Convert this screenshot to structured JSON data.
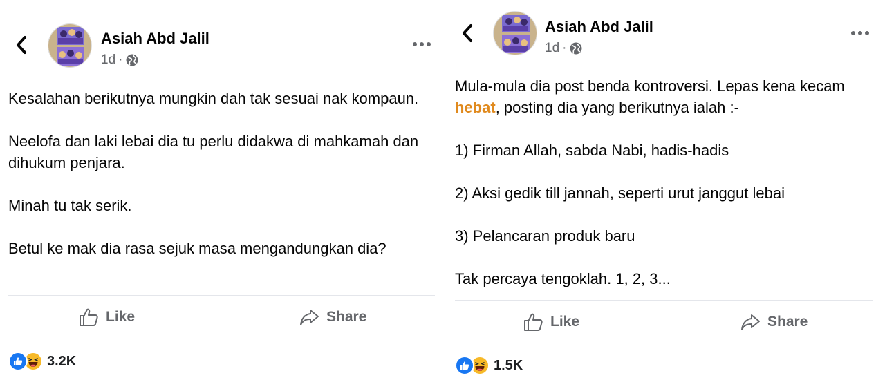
{
  "posts": [
    {
      "author": "Asiah Abd Jalil",
      "time": "1d",
      "separator": "·",
      "paragraphs": [
        "Kesalahan berikutnya mungkin dah tak sesuai nak kompaun.",
        "Neelofa dan laki lebai dia tu perlu didakwa di mahkamah dan dihukum penjara.",
        "Minah tu tak serik.",
        "Betul ke mak dia rasa sejuk masa mengandungkan dia?"
      ],
      "like_label": "Like",
      "share_label": "Share",
      "reaction_count": "3.2K"
    },
    {
      "author": "Asiah Abd Jalil",
      "time": "1d",
      "separator": "·",
      "intro_before": "Mula-mula dia post benda kontroversi. Lepas kena kecam ",
      "intro_highlight": "hebat",
      "intro_after": ", posting dia yang berikutnya ialah :-",
      "list": [
        "1) Firman Allah, sabda Nabi, hadis-hadis",
        "2) Aksi gedik till jannah, seperti urut janggut lebai",
        "3) Pelancaran produk baru"
      ],
      "closing": "Tak percaya tengoklah. 1, 2, 3...",
      "like_label": "Like",
      "share_label": "Share",
      "reaction_count": "1.5K"
    }
  ],
  "icons": {
    "back": "chevron-left-icon",
    "privacy": "globe-icon",
    "more": "more-horizontal-icon",
    "like": "thumbs-up-icon",
    "share": "share-arrow-icon",
    "reaction_like": "like-reaction-icon",
    "reaction_haha": "haha-reaction-icon"
  },
  "colors": {
    "highlight": "#e08a1e",
    "like_blue": "#1877f2",
    "haha_yellow": "#f7b928",
    "muted": "#65676b"
  }
}
